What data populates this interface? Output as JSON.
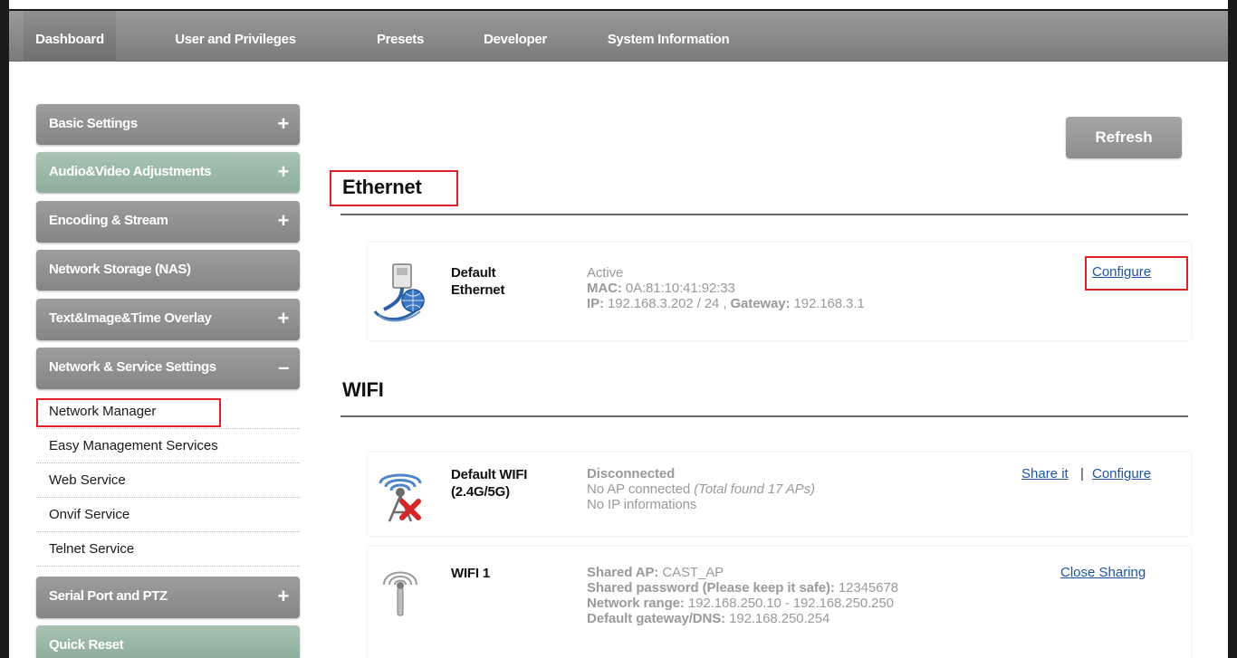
{
  "topnav": {
    "tabs": [
      {
        "label": "Dashboard",
        "active": true
      },
      {
        "label": "User and Privileges"
      },
      {
        "label": "Presets"
      },
      {
        "label": "Developer"
      },
      {
        "label": "System Information"
      }
    ]
  },
  "sidebar": {
    "groups": [
      {
        "label": "Basic Settings",
        "toggle": "+"
      },
      {
        "label": "Audio&Video Adjustments",
        "toggle": "+"
      },
      {
        "label": "Encoding & Stream",
        "toggle": "+"
      },
      {
        "label": "Network Storage (NAS)",
        "toggle": ""
      },
      {
        "label": "Text&Image&Time Overlay",
        "toggle": "+"
      },
      {
        "label": "Network & Service Settings",
        "toggle": "–"
      }
    ],
    "sub_items": [
      {
        "label": "Network Manager",
        "selected": true
      },
      {
        "label": "Easy Management Services"
      },
      {
        "label": "Web Service"
      },
      {
        "label": "Onvif Service"
      },
      {
        "label": "Telnet Service"
      }
    ],
    "groups_after": [
      {
        "label": "Serial Port and PTZ",
        "toggle": "+"
      },
      {
        "label": "Quick Reset",
        "toggle": ""
      }
    ]
  },
  "main": {
    "refresh_label": "Refresh",
    "ethernet": {
      "title": "Ethernet",
      "card": {
        "name_line1": "Default",
        "name_line2": "Ethernet",
        "status": "Active",
        "mac_label": "MAC:",
        "mac_value": "0A:81:10:41:92:33",
        "ip_label": "IP:",
        "ip_value": "192.168.3.202 / 24 ,",
        "gateway_label": "Gateway:",
        "gateway_value": "192.168.3.1",
        "configure": "Configure"
      }
    },
    "wifi": {
      "title": "WIFI",
      "cards": [
        {
          "name_line1": "Default WIFI",
          "name_line2": "(2.4G/5G)",
          "status": "Disconnected",
          "line2_a": "No AP connected",
          "line2_b": "(Total found 17 APs)",
          "line3": "No IP informations",
          "share": "Share it",
          "separator": "|",
          "configure": "Configure"
        },
        {
          "name_line1": "WIFI 1",
          "ap_label": "Shared AP:",
          "ap_value": "CAST_AP",
          "pw_label": "Shared password (Please keep it safe):",
          "pw_value": "12345678",
          "range_label": "Network range:",
          "range_value": "192.168.250.10 - 192.168.250.250",
          "gw_label": "Default gateway/DNS:",
          "gw_value": "192.168.250.254",
          "close_sharing": "Close Sharing"
        }
      ]
    }
  }
}
